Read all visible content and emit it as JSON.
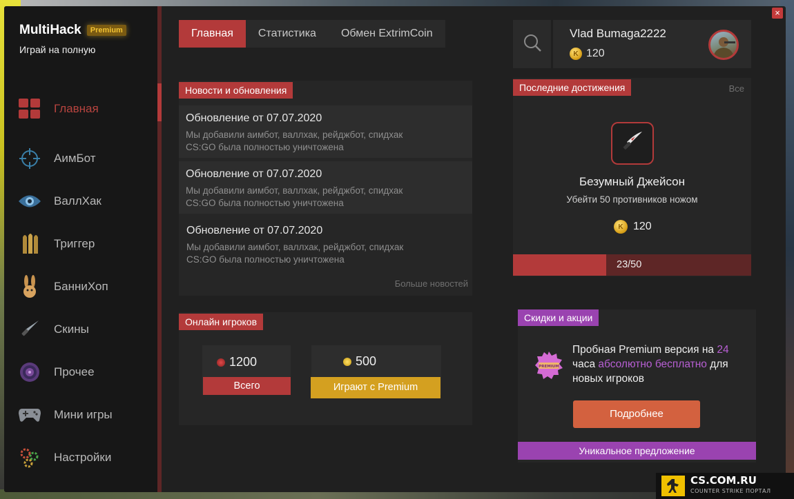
{
  "app": {
    "brand": "MultiHack",
    "premium_badge": "Premium",
    "tagline": "Играй на полную",
    "close_icon": "×"
  },
  "sidebar": {
    "items": [
      {
        "label": "Главная",
        "icon": "grid-icon",
        "active": true
      },
      {
        "label": "АимБот",
        "icon": "crosshair-icon"
      },
      {
        "label": "ВаллХак",
        "icon": "eye-icon"
      },
      {
        "label": "Триггер",
        "icon": "bullets-icon"
      },
      {
        "label": "БанниХоп",
        "icon": "bunny-icon"
      },
      {
        "label": "Скины",
        "icon": "knife-icon"
      },
      {
        "label": "Прочее",
        "icon": "target-icon"
      },
      {
        "label": "Мини игры",
        "icon": "gamepad-icon"
      },
      {
        "label": "Настройки",
        "icon": "gears-icon"
      }
    ]
  },
  "tabs": [
    {
      "label": "Главная",
      "active": true
    },
    {
      "label": "Статистика"
    },
    {
      "label": "Обмен ExtrimCoin"
    }
  ],
  "news": {
    "title": "Новости и обновления",
    "items": [
      {
        "title": "Обновление от 07.07.2020",
        "line1": "Мы добавили аимбот, валлхак, рейджбот, спидхак",
        "line2": "CS:GO была полностью уничтожена"
      },
      {
        "title": "Обновление от 07.07.2020",
        "line1": "Мы добавили аимбот, валлхак, рейджбот, спидхак",
        "line2": "CS:GO была полностью уничтожена"
      },
      {
        "title": "Обновление от 07.07.2020",
        "line1": "Мы добавили аимбот, валлхак, рейджбот, спидхак",
        "line2": "CS:GO была полностью уничтожена"
      }
    ],
    "more": "Больше новостей"
  },
  "online": {
    "title": "Онлайн игроков",
    "total": {
      "value": "1200",
      "label": "Всего",
      "color": "#b33a3a"
    },
    "premium": {
      "value": "500",
      "label": "Играют с Premium",
      "color": "#d4a020"
    }
  },
  "profile": {
    "username": "Vlad Bumaga2222",
    "balance": "120",
    "coin_letter": "K"
  },
  "achievements": {
    "title": "Последние достижения",
    "all_link": "Все",
    "name": "Безумный Джейсон",
    "description": "Убейти 50 противников ножом",
    "reward": "120",
    "progress_text": "23/50",
    "progress_fraction": 0.39
  },
  "promo": {
    "title": "Скидки и акции",
    "text_part1": "Пробная Premium версия на ",
    "highlight1": "24",
    "text_part2": " часа ",
    "highlight2": "абсолютно бесплатно",
    "text_part3": " для новых игроков",
    "badge_text": "PREMIUM",
    "button": "Подробнее",
    "bar": "Уникальное предложение"
  },
  "watermark": {
    "site": "CS.COM.RU",
    "subtitle": "COUNTER STRIKE ПОРТАЛ"
  },
  "colors": {
    "accent": "#b33a3a",
    "accent_dark": "#5e2626",
    "gold": "#d4a020",
    "purple": "#9a43b0",
    "orange": "#d3613f",
    "bg": "#202020"
  }
}
